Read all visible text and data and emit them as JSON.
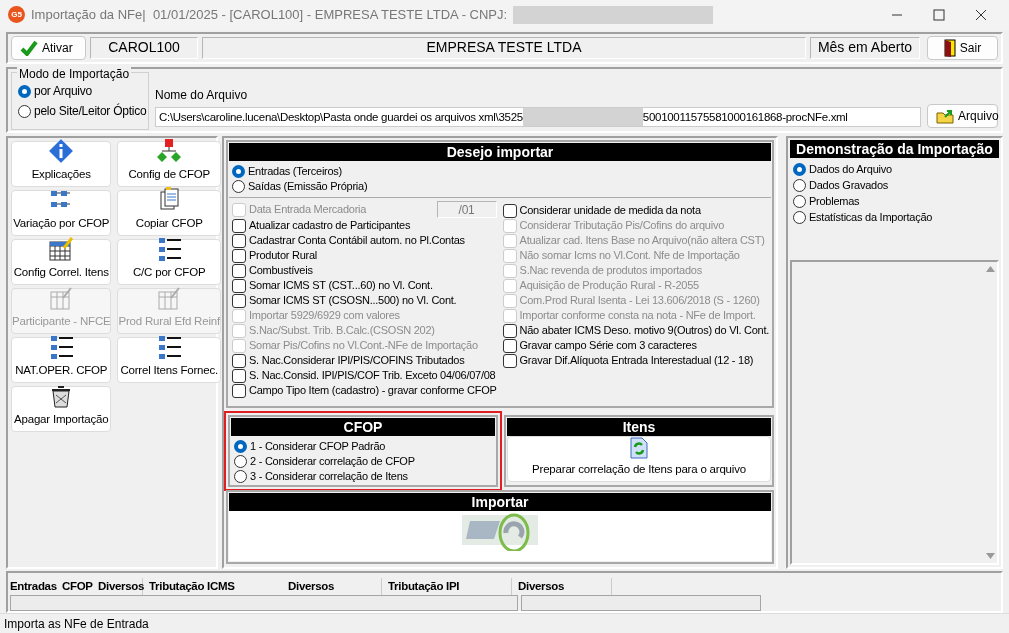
{
  "window": {
    "icon_text": "G5",
    "title": "Importação da NFe|  01/01/2025 - [CAROL100] - EMPRESA TESTE LTDA - CNPJ:"
  },
  "toolbar": {
    "activate_button": "Ativar",
    "user": "CAROL100",
    "company": "EMPRESA TESTE LTDA",
    "period": "Mês em Aberto",
    "exit_button": "Sair"
  },
  "import_mode": {
    "title": "Modo de Importação",
    "options": [
      {
        "label": "por Arquivo",
        "selected": true
      },
      {
        "label": "pelo Site/Leitor Óptico",
        "selected": false
      }
    ]
  },
  "file": {
    "label": "Nome do Arquivo",
    "value_start": "C:\\Users\\caroline.lucena\\Desktop\\Pasta onde guardei os arquivos xml\\3525",
    "value_end": "50010011575581000161868-procNFe.xml",
    "button": "Arquivo"
  },
  "actions": [
    {
      "label": "Explicações",
      "disabled": false
    },
    {
      "label": "Config de CFOP",
      "disabled": false
    },
    {
      "label": "Variação por CFOP",
      "disabled": false
    },
    {
      "label": "Copiar CFOP",
      "disabled": false
    },
    {
      "label": "Config Correl. Itens",
      "disabled": false
    },
    {
      "label": "C/C por CFOP",
      "disabled": false
    },
    {
      "label": "Participante - NFCE",
      "disabled": true
    },
    {
      "label": "Prod Rural Efd Reinf",
      "disabled": true
    },
    {
      "label": "NAT.OPER. CFOP",
      "disabled": false
    },
    {
      "label": "Correl Itens Fornec.",
      "disabled": false
    },
    {
      "label": "Apagar Importação",
      "disabled": false
    }
  ],
  "desejo": {
    "title": "Desejo importar",
    "direction": [
      {
        "label": "Entradas (Terceiros)",
        "selected": true
      },
      {
        "label": "Saídas (Emissão Própria)",
        "selected": false
      }
    ],
    "options_left": [
      {
        "label": "Data Entrada Mercadoria",
        "checked": false,
        "disabled": true,
        "kind": "date",
        "value": "/01"
      },
      {
        "label": "Atualizar cadastro de Participantes",
        "checked": false,
        "disabled": false,
        "kind": "check"
      },
      {
        "label": "Cadastrar Conta Contábil autom. no Pl.Contas",
        "checked": false,
        "disabled": false,
        "kind": "check"
      },
      {
        "label": "Produtor Rural",
        "checked": false,
        "disabled": false,
        "kind": "check"
      },
      {
        "label": "Combustíveis",
        "checked": false,
        "disabled": false,
        "kind": "check"
      },
      {
        "label": "Somar ICMS ST (CST...60) no Vl. Cont.",
        "checked": false,
        "disabled": false,
        "kind": "check"
      },
      {
        "label": "Somar ICMS ST (CSOSN...500) no Vl. Cont.",
        "checked": false,
        "disabled": false,
        "kind": "check"
      },
      {
        "label": "Importar 5929/6929 com valores",
        "checked": false,
        "disabled": true,
        "kind": "check"
      },
      {
        "label": "S.Nac/Subst. Trib. B.Calc.(CSOSN 202)",
        "checked": false,
        "disabled": true,
        "kind": "check"
      },
      {
        "label": "Somar Pis/Cofins no Vl.Cont.-NFe de Importação",
        "checked": false,
        "disabled": true,
        "kind": "check"
      },
      {
        "label": "S. Nac.Considerar IPI/PIS/COFINS Tributados",
        "checked": false,
        "disabled": false,
        "kind": "check"
      },
      {
        "label": "S. Nac.Consid. IPI/PIS/COF Trib. Exceto 04/06/07/08",
        "checked": false,
        "disabled": false,
        "kind": "check"
      },
      {
        "label": "Campo Tipo Item (cadastro) - gravar conforme CFOP",
        "checked": false,
        "disabled": false,
        "kind": "check"
      }
    ],
    "options_right": [
      {
        "label": "Considerar unidade de medida da nota",
        "checked": false,
        "disabled": false
      },
      {
        "label": "Considerar Tributação Pis/Cofins do arquivo",
        "checked": false,
        "disabled": true
      },
      {
        "label": "Atualizar cad. Itens Base no Arquivo(não altera CST)",
        "checked": false,
        "disabled": true
      },
      {
        "label": "Não somar Icms no Vl.Cont. Nfe de Importação",
        "checked": false,
        "disabled": true
      },
      {
        "label": "S.Nac revenda de produtos importados",
        "checked": false,
        "disabled": true
      },
      {
        "label": "Aquisição de Produção Rural - R-2055",
        "checked": false,
        "disabled": true
      },
      {
        "label": "Com.Prod Rural Isenta - Lei 13.606/2018 (S - 1260)",
        "checked": false,
        "disabled": true
      },
      {
        "label": "Importar conforme consta na nota - NFe de Import.",
        "checked": false,
        "disabled": true
      },
      {
        "label": "Não abater ICMS Deso. motivo 9(Outros) do Vl. Cont.",
        "checked": false,
        "disabled": false
      },
      {
        "label": "Gravar campo Série com 3 caracteres",
        "checked": false,
        "disabled": false
      },
      {
        "label": "Gravar Dif.Alíquota Entrada Interestadual (12 - 18)",
        "checked": false,
        "disabled": false
      }
    ]
  },
  "cfop": {
    "title": "CFOP",
    "options": [
      {
        "label": "1 - Considerar CFOP Padrão",
        "selected": true
      },
      {
        "label": "2 - Considerar correlação de CFOP",
        "selected": false
      },
      {
        "label": "3 - Considerar correlação de Itens",
        "selected": false
      }
    ]
  },
  "itens": {
    "title": "Itens",
    "button": "Preparar correlação de Itens para o arquivo"
  },
  "importar": {
    "title": "Importar"
  },
  "demo": {
    "title": "Demonstração da Importação",
    "options": [
      {
        "label": "Dados do Arquivo",
        "selected": true
      },
      {
        "label": "Dados Gravados",
        "selected": false
      },
      {
        "label": "Problemas",
        "selected": false
      },
      {
        "label": "Estatísticas da Importação",
        "selected": false
      }
    ]
  },
  "summary": {
    "columns": [
      "Entradas",
      "CFOP",
      "Diversos",
      "Tributação ICMS",
      "Diversos",
      "Tributação IPI",
      "Diversos"
    ]
  },
  "status_bar": "Importa as NFe de Entrada"
}
